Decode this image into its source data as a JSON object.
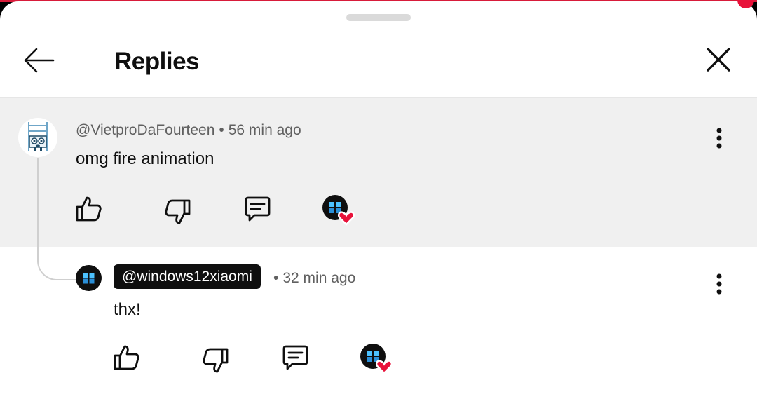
{
  "header": {
    "title": "Replies"
  },
  "parent_comment": {
    "author": "@VietproDaFourteen",
    "time": "56 min ago",
    "text": "omg fire animation"
  },
  "reply": {
    "author": "@windows12xiaomi",
    "time": "32 min ago",
    "text": "thx!"
  },
  "separator": "•",
  "colors": {
    "accent": "#e8123a",
    "highlight_bg": "#f0f0f0",
    "text": "#0f0f0f",
    "meta": "#606060"
  },
  "icons": [
    "back-arrow-icon",
    "close-icon",
    "like-icon",
    "dislike-icon",
    "reply-icon",
    "creator-heart-icon",
    "more-options-icon"
  ]
}
